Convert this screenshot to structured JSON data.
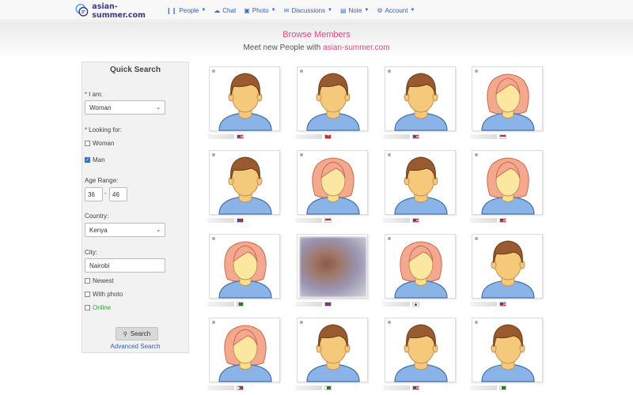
{
  "header": {
    "logo_text": "asian-summer.com",
    "nav": [
      {
        "label": "People",
        "icon": "people-icon",
        "glyph": "❙❙",
        "caret": true
      },
      {
        "label": "Chat",
        "icon": "chat-icon",
        "glyph": "☁",
        "caret": false
      },
      {
        "label": "Photo",
        "icon": "photo-icon",
        "glyph": "▣",
        "caret": true
      },
      {
        "label": "Discussions",
        "icon": "discussions-icon",
        "glyph": "✉",
        "caret": true
      },
      {
        "label": "Note",
        "icon": "note-icon",
        "glyph": "▤",
        "caret": true
      },
      {
        "label": "Account",
        "icon": "gear-icon",
        "glyph": "⚙",
        "caret": true
      }
    ]
  },
  "band": {
    "title": "Browse Members",
    "subtitle": "Meet new People with",
    "site": "asian-summer.com"
  },
  "quick_search": {
    "title": "Quick Search",
    "i_am_label": "I am:",
    "i_am_value": "Woman",
    "looking_for_label": "Looking for:",
    "looking_woman": "Woman",
    "looking_man": "Man",
    "age_range_label": "Age Range:",
    "age_min": "36",
    "age_max": "46",
    "age_sep": "-",
    "country_label": "Country:",
    "country_value": "Kenya",
    "city_label": "City:",
    "city_value": "Nairobi",
    "newest": "Newest",
    "with_photo": "With photo",
    "online": "Online",
    "search_button": "Search",
    "advanced_link": "Advanced Search"
  },
  "members": [
    {
      "avatar": "male",
      "flag": "us"
    },
    {
      "avatar": "male",
      "flag": "ch"
    },
    {
      "avatar": "male",
      "flag": "us"
    },
    {
      "avatar": "female",
      "flag": "sg"
    },
    {
      "avatar": "male",
      "flag": "gb"
    },
    {
      "avatar": "female",
      "flag": "sg"
    },
    {
      "avatar": "male",
      "flag": "us"
    },
    {
      "avatar": "female",
      "flag": "us"
    },
    {
      "avatar": "female",
      "flag": "pk"
    },
    {
      "avatar": "photo",
      "flag": "gb"
    },
    {
      "avatar": "female",
      "flag": "kr"
    },
    {
      "avatar": "male",
      "flag": "us"
    },
    {
      "avatar": "female",
      "flag": "ph"
    },
    {
      "avatar": "male",
      "flag": "pk"
    },
    {
      "avatar": "male",
      "flag": "us"
    },
    {
      "avatar": "male",
      "flag": "pk"
    }
  ],
  "colors": {
    "accent_pink": "#e0458c",
    "link_blue": "#2f5db7",
    "male_hair": "#9a5a30",
    "female_hair": "#f4a88e",
    "skin": "#f4c97a",
    "shirt": "#8ab4e8"
  }
}
